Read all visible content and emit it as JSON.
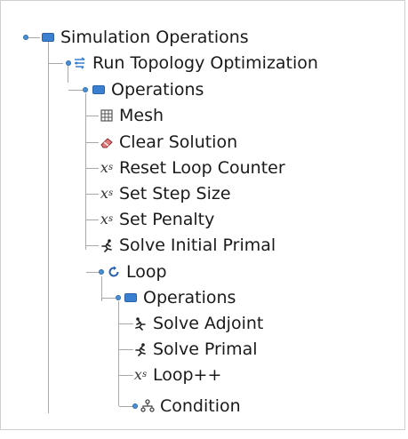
{
  "tree": {
    "root": {
      "label": "Simulation Operations",
      "icon": "folder-icon"
    },
    "run": {
      "label": "Run Topology Optimization",
      "icon": "optimization-icon"
    },
    "operations": {
      "label": "Operations",
      "icon": "folder-icon"
    },
    "mesh": {
      "label": "Mesh",
      "icon": "mesh-grid-icon"
    },
    "clear_solution": {
      "label": "Clear Solution",
      "icon": "eraser-icon"
    },
    "reset_loop_counter": {
      "label": "Reset Loop Counter",
      "icon": "variable-xs-icon"
    },
    "set_step_size": {
      "label": "Set Step Size",
      "icon": "variable-xs-icon"
    },
    "set_penalty": {
      "label": "Set Penalty",
      "icon": "variable-xs-icon"
    },
    "solve_initial_primal": {
      "label": "Solve Initial Primal",
      "icon": "runner-icon"
    },
    "loop": {
      "label": "Loop",
      "icon": "loop-icon"
    },
    "loop_operations": {
      "label": "Operations",
      "icon": "folder-icon"
    },
    "solve_adjoint": {
      "label": "Solve Adjoint",
      "icon": "runner-reverse-icon"
    },
    "solve_primal": {
      "label": "Solve Primal",
      "icon": "runner-icon"
    },
    "loop_increment": {
      "label": "Loop++",
      "icon": "variable-xs-icon"
    },
    "condition": {
      "label": "Condition",
      "icon": "condition-icon"
    }
  },
  "icon_glyph": {
    "xs": "x",
    "xs_sub": "s"
  },
  "colors": {
    "accent": "#3a7fd0",
    "tree_line": "#a8a8a8",
    "toggle": "#4a90d6"
  }
}
